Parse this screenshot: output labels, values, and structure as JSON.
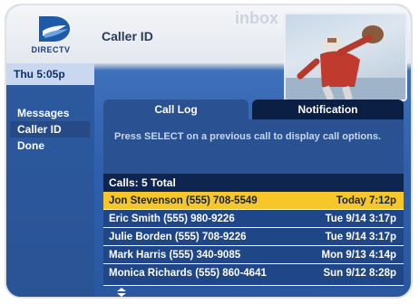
{
  "header": {
    "logo_text": "DIRECTV",
    "title": "Caller ID",
    "watermark": "inbox"
  },
  "sidebar": {
    "time": "Thu 5:05p",
    "items": [
      {
        "label": "Messages",
        "selected": false
      },
      {
        "label": "Caller ID",
        "selected": true
      },
      {
        "label": "Done",
        "selected": false
      }
    ]
  },
  "tabs": [
    {
      "label": "Call Log",
      "active": true
    },
    {
      "label": "Notification",
      "active": false
    }
  ],
  "panel": {
    "instructions": "Press SELECT on a previous call to display call options."
  },
  "call_log": {
    "total_label": "Calls: 5 Total",
    "calls": [
      {
        "caller": "Jon Stevenson (555) 708-5549",
        "when": "Today 7:12p",
        "highlighted": true
      },
      {
        "caller": "Eric Smith (555) 980-9226",
        "when": "Tue 9/14 3:17p",
        "highlighted": false
      },
      {
        "caller": "Julie Borden (555) 708-9226",
        "when": "Tue 9/14 3:17p",
        "highlighted": false
      },
      {
        "caller": "Mark Harris (555) 340-9085",
        "when": "Mon 9/13 4:14p",
        "highlighted": false
      },
      {
        "caller": "Monica Richards (555) 860-4641",
        "when": "Sun 9/12 8:28p",
        "highlighted": false
      }
    ]
  },
  "colors": {
    "highlight": "#f7c628",
    "row": "#1f4687",
    "background": "#2f5fae"
  }
}
